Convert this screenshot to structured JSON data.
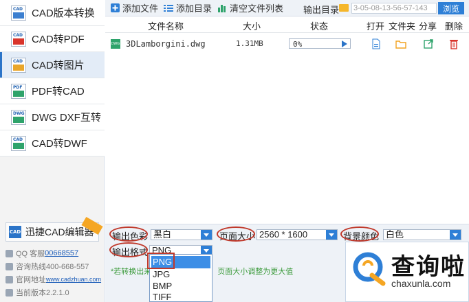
{
  "sidebar": {
    "items": [
      {
        "label": "CAD版本转换",
        "icon": "cad-version-icon"
      },
      {
        "label": "CAD转PDF",
        "icon": "cad-to-pdf-icon"
      },
      {
        "label": "CAD转图片",
        "icon": "cad-to-image-icon",
        "active": true
      },
      {
        "label": "PDF转CAD",
        "icon": "pdf-to-cad-icon"
      },
      {
        "label": "DWG DXF互转",
        "icon": "dwg-dxf-icon"
      },
      {
        "label": "CAD转DWF",
        "icon": "cad-to-dwf-icon"
      }
    ],
    "brand": "迅捷CAD编辑器",
    "info": {
      "qq_label": "QQ 客服",
      "qq_number": "00668557",
      "hotline": "咨询热线400-668-557",
      "website_label": "官网地址",
      "website": "www.cadzhuan.com",
      "version": "当前版本2.2.1.0"
    }
  },
  "toolbar": {
    "add_file": "添加文件",
    "add_dir": "添加目录",
    "clear_list": "清空文件列表",
    "output_dir_label": "输出目录",
    "output_path": "3-05-08-13-56-57-143",
    "browse": "浏览"
  },
  "table": {
    "headers": {
      "name": "文件名称",
      "size": "大小",
      "status": "状态",
      "open": "打开",
      "folder": "文件夹",
      "share": "分享",
      "delete": "删除"
    },
    "rows": [
      {
        "name": "3DLamborgini.dwg",
        "size": "1.31MB",
        "progress_text": "0%",
        "progress": 0
      }
    ]
  },
  "settings": {
    "color_label": "输出色彩",
    "color_value": "黑白",
    "page_size_label": "页面大小",
    "page_size_value": "2560 * 1600",
    "bg_color_label": "背景颜色",
    "bg_color_value": "白色",
    "format_label": "输出格式",
    "format_value": "PNG",
    "note_start": "*若转换出来",
    "note_end": "页面大小调整为更大值",
    "format_options": [
      "PNG",
      "JPG",
      "BMP",
      "TIFF"
    ]
  },
  "watermark": {
    "text": "查询啦",
    "url": "chaxunla.com"
  },
  "colors": {
    "accent": "#2e7fd6",
    "highlight": "#c0392b",
    "note_green": "#3a9a3a"
  }
}
